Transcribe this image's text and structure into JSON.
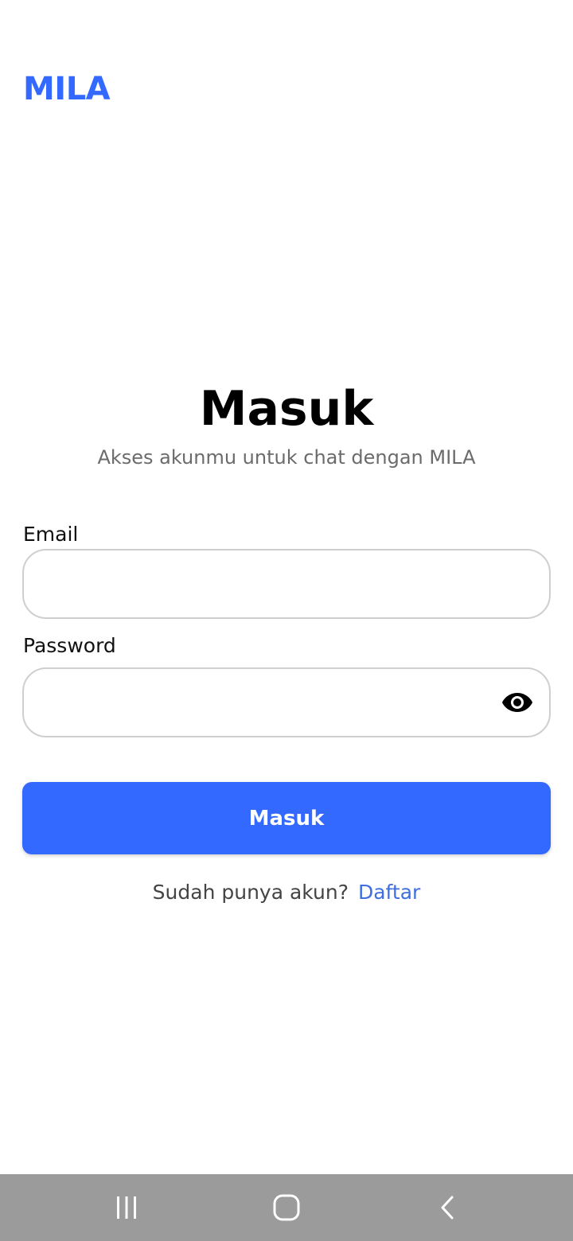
{
  "app": {
    "brand": "MILA"
  },
  "login": {
    "title": "Masuk",
    "subtitle": "Akses akunmu untuk chat dengan MILA",
    "email_label": "Email",
    "email_value": "",
    "password_label": "Password",
    "password_value": "",
    "password_toggle_icon": "eye-icon",
    "submit_label": "Masuk",
    "footer_text": "Sudah punya akun?",
    "register_link": "Daftar"
  },
  "system_nav": {
    "recent_icon": "recent-apps-icon",
    "home_icon": "home-icon",
    "back_icon": "back-icon"
  },
  "colors": {
    "brand": "#3369FF",
    "primary_button": "#3369FF",
    "link": "#3E6FE0",
    "input_border": "#CFCFCF",
    "nav_bar": "#9B9B9B"
  }
}
